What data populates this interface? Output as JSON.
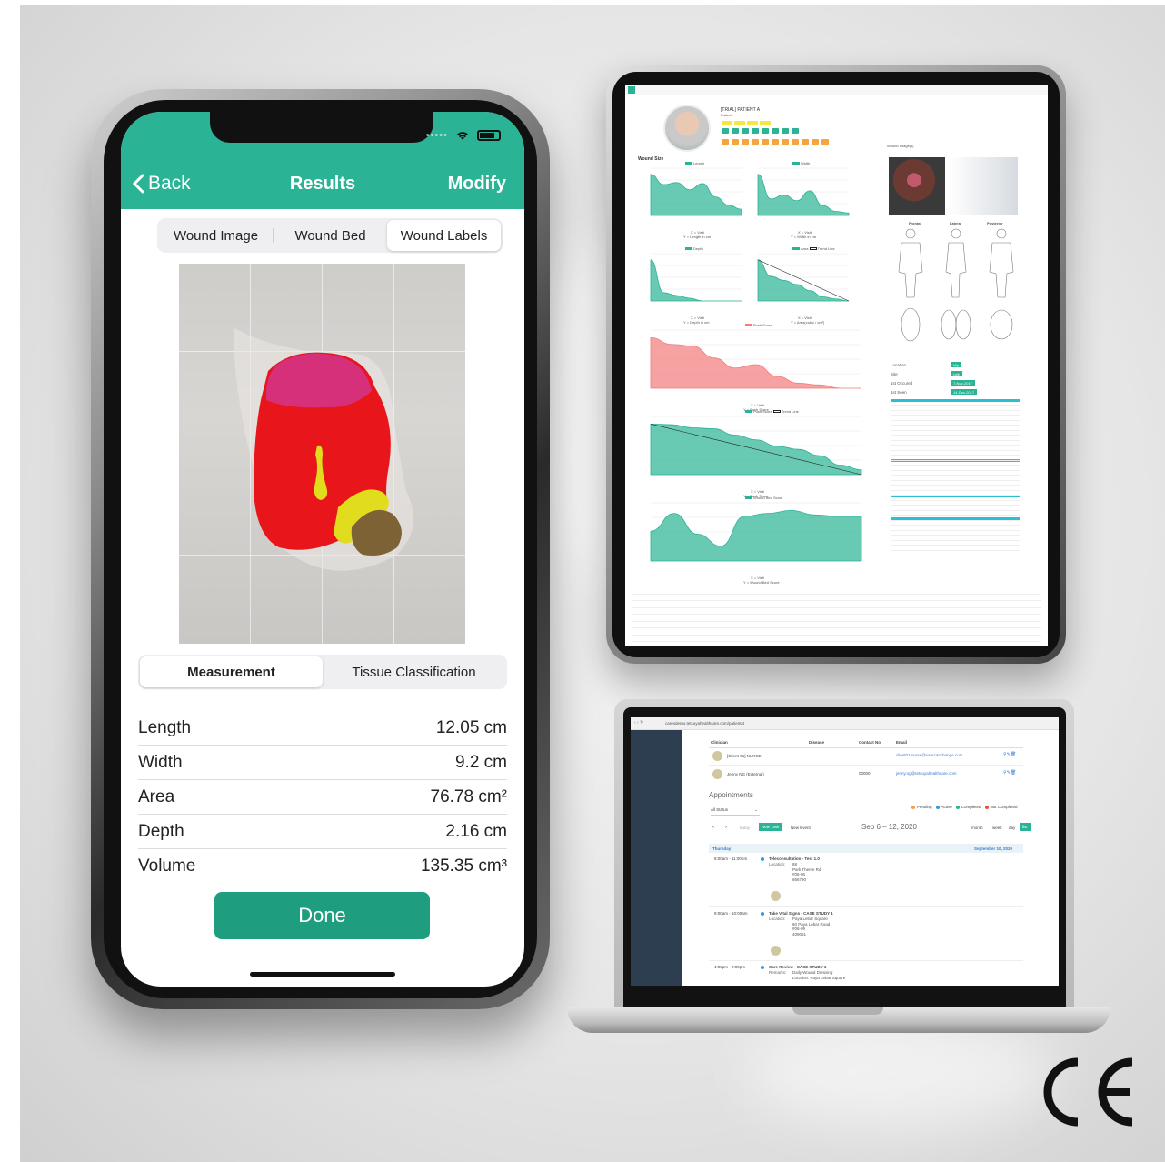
{
  "phone": {
    "nav": {
      "back_label": "Back",
      "title": "Results",
      "modify_label": "Modify"
    },
    "image_tabs": [
      "Wound Image",
      "Wound Bed",
      "Wound Labels"
    ],
    "image_tabs_active": 2,
    "info_tabs": [
      "Measurement",
      "Tissue Classification"
    ],
    "info_tabs_active": 0,
    "measurements": [
      {
        "label": "Length",
        "value": "12.05 cm"
      },
      {
        "label": "Width",
        "value": "9.2 cm"
      },
      {
        "label": "Area",
        "value": "76.78 cm²"
      },
      {
        "label": "Depth",
        "value": "2.16 cm"
      },
      {
        "label": "Volume",
        "value": "135.35 cm³"
      }
    ],
    "done_label": "Done",
    "wound_label_colors": {
      "granulation": "#e8151b",
      "slough": "#e2dc1e",
      "eschar": "#7d6236",
      "epithelial": "#d7307b"
    }
  },
  "tablet": {
    "patient_name": "[TRIAL] PATIENT A",
    "patient_role": "Patient",
    "section_title": "Wound Size",
    "wound_images_title": "Wound Image(s)",
    "body_views": [
      "Frontal",
      "Lateral",
      "Posterior"
    ],
    "charts": [
      {
        "legend": "Length",
        "xlabel": "X = Visit",
        "ylabel": "Y = Length in cm",
        "values": [
          4,
          3,
          3.2,
          2.5,
          3.1,
          1.8,
          1,
          0.6
        ]
      },
      {
        "legend": "Width",
        "xlabel": "X = Visit",
        "ylabel": "Y = Width in cm",
        "values": [
          5,
          2,
          2.5,
          1.8,
          3,
          1.2,
          0.5,
          0.3
        ]
      },
      {
        "legend": "Depth",
        "xlabel": "X = Visit",
        "ylabel": "Y = Depth in cm",
        "values": [
          1.5,
          0.3,
          0.2,
          0.1,
          0,
          0,
          0,
          0
        ]
      },
      {
        "legend": "Area",
        "legend2": "Trend Line",
        "xlabel": "X = Visit",
        "ylabel": "Y = Area(cubic / cm²)",
        "values": [
          20,
          12,
          10,
          8,
          5,
          2,
          1,
          0
        ]
      },
      {
        "legend": "Push Score",
        "xlabel": "X = Visit",
        "ylabel": "Y = Push Score",
        "values": [
          3,
          2.6,
          2.5,
          1.8,
          1.2,
          1.4,
          0.7,
          0.3,
          0.2,
          0,
          0
        ]
      },
      {
        "legend": "Push Score",
        "legend2": "Trend Line",
        "xlabel": "X = Visit",
        "ylabel": "Y = Push Score",
        "values": [
          16,
          15.8,
          14.8,
          14.5,
          12.5,
          11,
          9,
          8,
          6,
          3,
          1.5
        ]
      },
      {
        "legend": "Wound Bed Score",
        "xlabel": "X = Visit",
        "ylabel": "Y = Wound Bed Score",
        "values": [
          10,
          16,
          9,
          5,
          15,
          16,
          17,
          15.5,
          15,
          15
        ]
      }
    ],
    "location_rows": [
      {
        "label": "Location",
        "value": "Hip"
      },
      {
        "label": "Site",
        "value": "Left"
      },
      {
        "label": "1st Occured",
        "value": "7-Nov-2017"
      },
      {
        "label": "1st Seen",
        "value": "14-Dec-2017"
      }
    ],
    "accent": "#2ab394",
    "score_color": "#f37b7b"
  },
  "laptop": {
    "url": "caresdemo.tetsuyahealthcare.com/patient/4",
    "columns": [
      "Clinician",
      "Disease",
      "Contact No.",
      "Email"
    ],
    "clinicians": [
      {
        "name": "[Client-01] NURSE",
        "contact": "",
        "email": "client01-nurse@usercanchange.com"
      },
      {
        "name": "Jenny NG (External)",
        "contact": "00000",
        "email": "jenny.ng@tetsuyahealthcare.com"
      }
    ],
    "appointments_title": "Appointments",
    "status_filter": "All Status",
    "legend": [
      {
        "label": "Pending",
        "color": "#f39c4b"
      },
      {
        "label": "Active",
        "color": "#3498db"
      },
      {
        "label": "Completed",
        "color": "#2ab394"
      },
      {
        "label": "Not Completed",
        "color": "#e74c3c"
      }
    ],
    "toolbar": {
      "today": "today",
      "new_task": "New Task",
      "new_event": "New Event",
      "range": "Sep 6 – 12, 2020",
      "views": [
        "month",
        "week",
        "day",
        "list"
      ]
    },
    "day_header": "Thursday",
    "day_date": "September 10, 2020",
    "events": [
      {
        "time": "8:00am - 11:00pm",
        "title": "Teleconsultation - Test 1.0",
        "location": "Location:",
        "lines": [
          "88",
          "Park Theme Rd",
          "#06-06",
          "666790"
        ]
      },
      {
        "time": "9:00am - 10:00am",
        "title": "Take Vital Signs - CASE STUDY 1",
        "location": "Location:",
        "lines": [
          "Paya Lebar Square",
          "60 Paya Lebar Road",
          "#06-09",
          "409051"
        ]
      },
      {
        "time": "4:00pm - 9:00pm",
        "title": "Care Review - CASE STUDY 1",
        "location": "Remarks:",
        "lines": [
          "Daily Wound Dressing",
          "Location: Paya Lebar Square"
        ]
      }
    ]
  },
  "certification": "CE"
}
